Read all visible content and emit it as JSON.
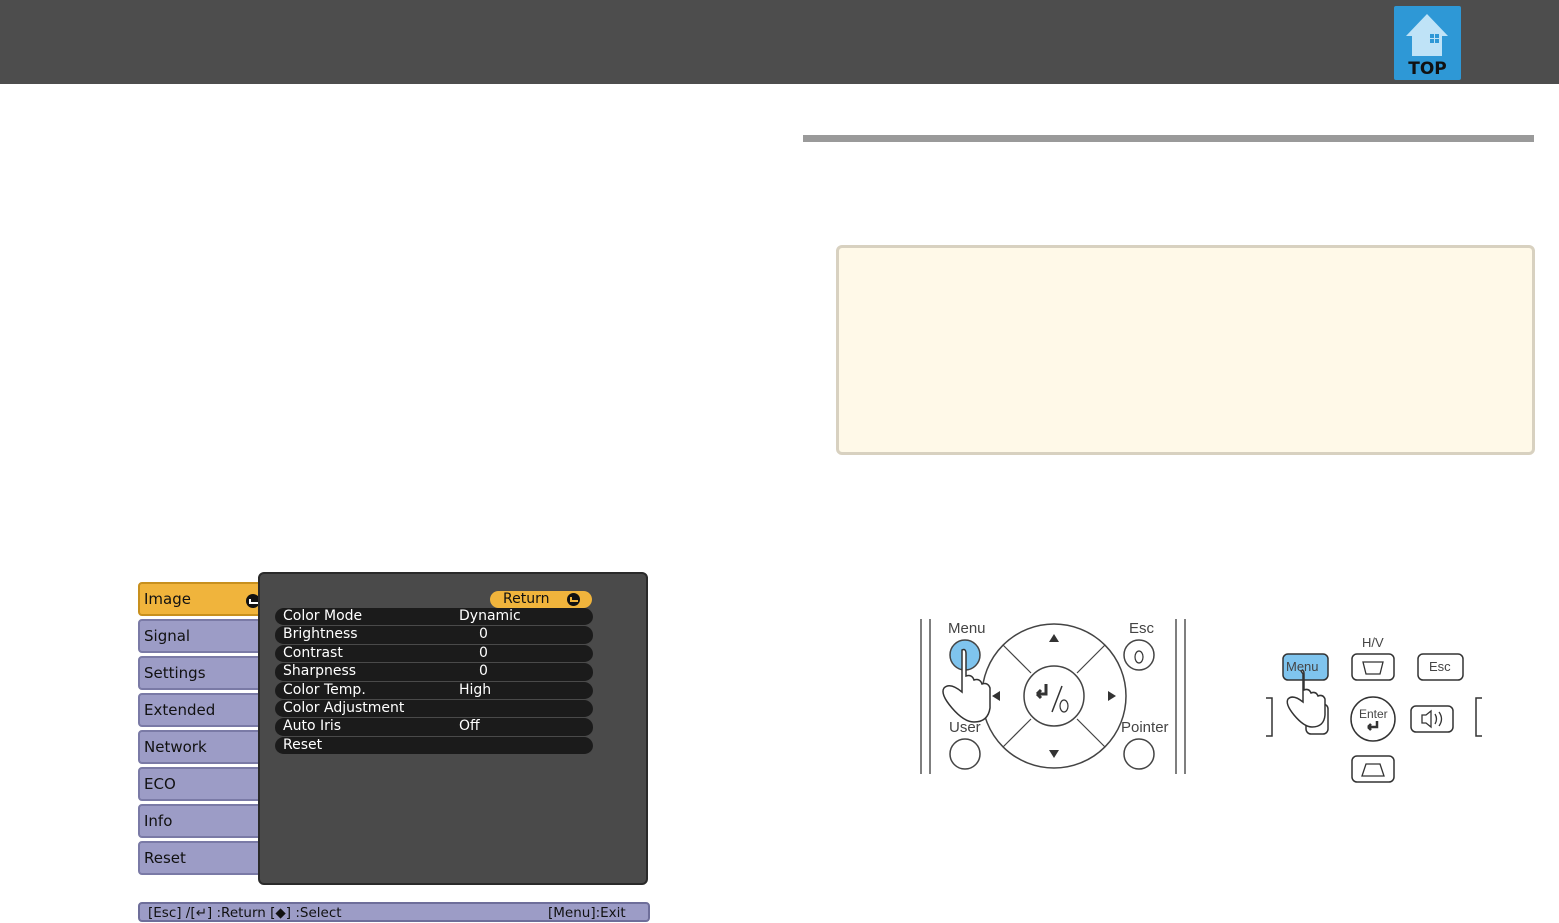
{
  "header": {
    "top_link_label": "TOP"
  },
  "projector_menu": {
    "tabs": [
      {
        "label": "Image",
        "active": true
      },
      {
        "label": "Signal",
        "active": false
      },
      {
        "label": "Settings",
        "active": false
      },
      {
        "label": "Extended",
        "active": false
      },
      {
        "label": "Network",
        "active": false
      },
      {
        "label": "ECO",
        "active": false
      },
      {
        "label": "Info",
        "active": false
      },
      {
        "label": "Reset",
        "active": false
      }
    ],
    "return_label": "Return",
    "items": [
      {
        "label": "Color Mode",
        "value": "Dynamic"
      },
      {
        "label": "Brightness",
        "value": "0"
      },
      {
        "label": "Contrast",
        "value": "0"
      },
      {
        "label": "Sharpness",
        "value": "0"
      },
      {
        "label": "Color Temp.",
        "value": "High"
      },
      {
        "label": "Color Adjustment",
        "value": ""
      },
      {
        "label": "Auto Iris",
        "value": "Off"
      },
      {
        "label": "Reset",
        "value": ""
      }
    ],
    "footer_left": "[Esc] /[↵] :Return  [◆] :Select",
    "footer_right": "[Menu]:Exit"
  },
  "remote_figure": {
    "menu_label": "Menu",
    "esc_label": "Esc",
    "user_label": "User",
    "pointer_label": "Pointer"
  },
  "panel_figure": {
    "hv_label": "H/V",
    "menu_label": "Menu",
    "esc_label": "Esc",
    "enter_label": "Enter"
  },
  "colors": {
    "top_bar": "#4d4d4d",
    "top_icon": "#2e98d6",
    "note_background": "#fff9e8",
    "menu_button_highlight": "#7fc4ee",
    "osd_active_tab": "#f0b43c",
    "osd_tab": "#9c9cc6"
  }
}
